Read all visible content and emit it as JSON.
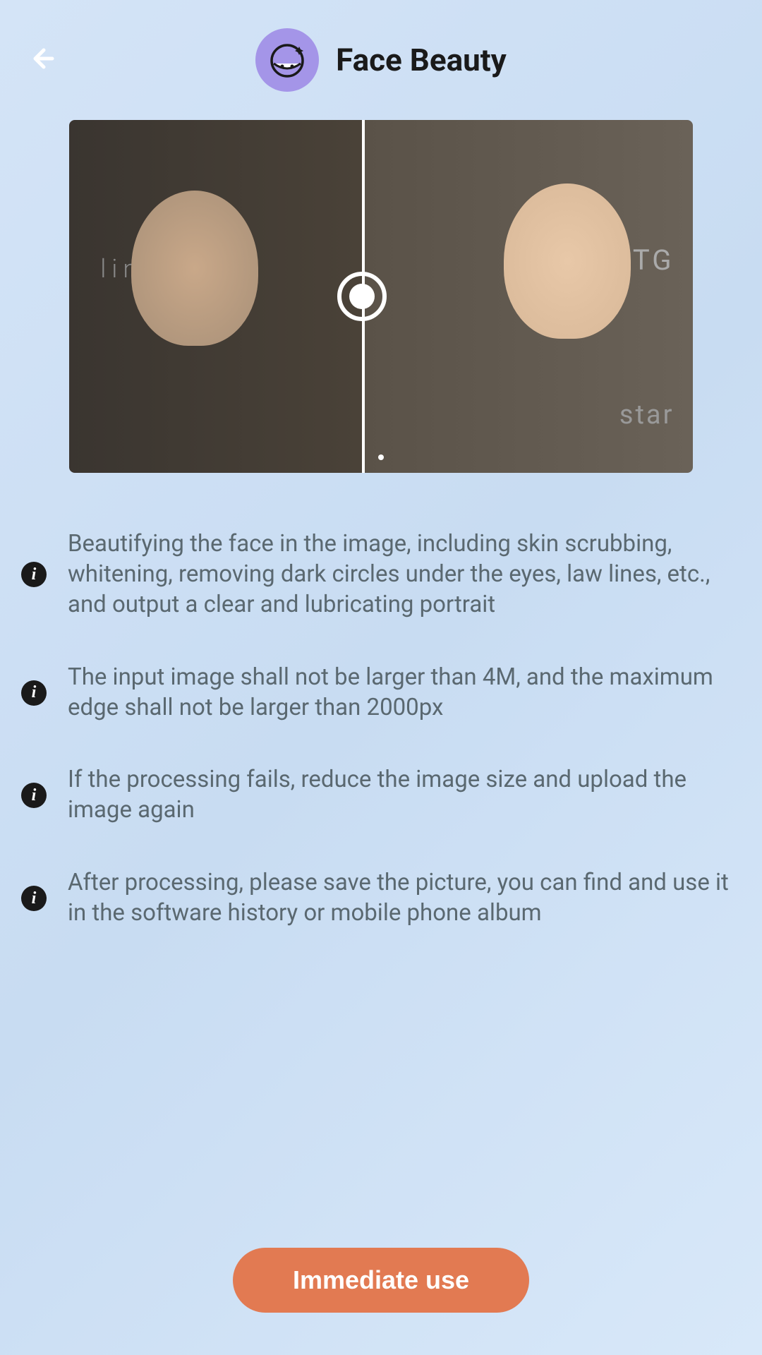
{
  "header": {
    "title": "Face Beauty"
  },
  "preview": {
    "bg_text_left": "lin",
    "bg_text_right": "RSTG",
    "bg_text_right_2": "star"
  },
  "info_items": [
    {
      "text": "Beautifying the face in the image, including skin scrubbing, whitening, removing dark circles under the eyes, law lines, etc., and output a clear and lubricating portrait"
    },
    {
      "text": "The input image shall not be larger than 4M, and the maximum edge shall not be larger than 2000px"
    },
    {
      "text": "If the processing fails, reduce the image size and upload the image again"
    },
    {
      "text": "After processing, please save the picture, you can find and use it in the software history or mobile phone album"
    }
  ],
  "cta": {
    "label": "Immediate use"
  }
}
